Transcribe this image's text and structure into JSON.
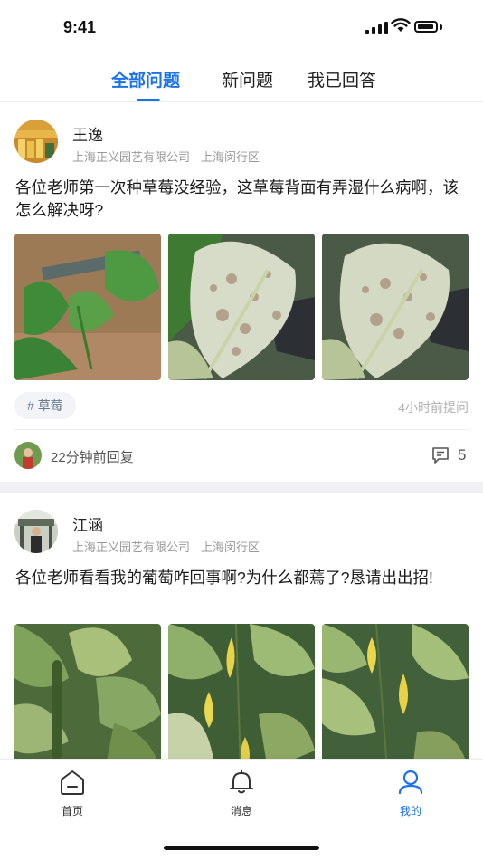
{
  "status_bar": {
    "time": "9:41"
  },
  "tabs": [
    {
      "label": "全部问题",
      "active": true
    },
    {
      "label": "新问题",
      "active": false
    },
    {
      "label": "我已回答",
      "active": false
    }
  ],
  "posts": [
    {
      "user": "王逸",
      "company": "上海正义园艺有限公司",
      "location": "上海闵行区",
      "question": "各位老师第一次种草莓没经验，这草莓背面有弄湿什么病啊，该怎么解决呀?",
      "tag": "草莓",
      "tag_prefix": "#",
      "asked": "4小时前提问",
      "reply_time": "22分钟前回复",
      "comment_count": "5"
    },
    {
      "user": "江涵",
      "company": "上海正义园艺有限公司",
      "location": "上海闵行区",
      "question": "各位老师看看我的葡萄咋回事啊?为什么都蔫了?恳请出出招!"
    }
  ],
  "bottom_nav": [
    {
      "label": "首页",
      "icon": "home-icon",
      "active": false
    },
    {
      "label": "消息",
      "icon": "bell-icon",
      "active": false
    },
    {
      "label": "我的",
      "icon": "profile-icon",
      "active": true
    }
  ],
  "colors": {
    "accent": "#1b73e8",
    "tag_bg": "#f2f4f7",
    "separator": "#f0f1f4"
  }
}
